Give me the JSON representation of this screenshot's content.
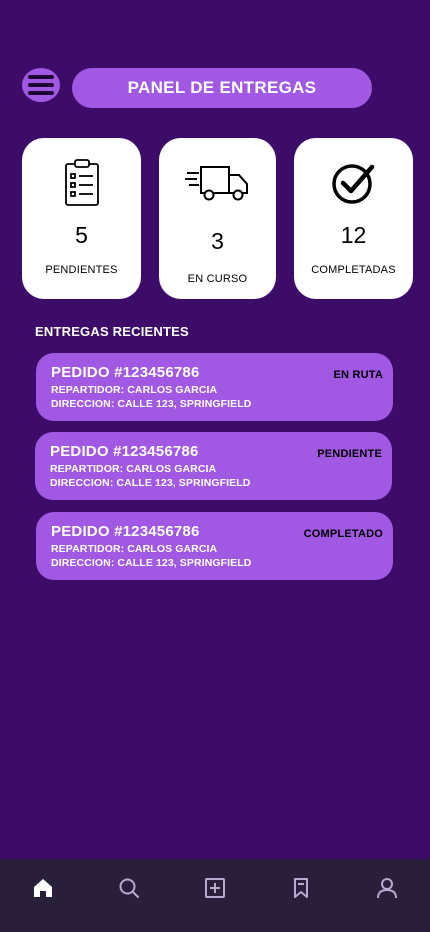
{
  "header": {
    "title": "PANEL DE ENTREGAS",
    "menu_icon": "hamburger-menu-icon"
  },
  "stats": [
    {
      "icon": "clipboard-list-icon",
      "value": "5",
      "label": "PENDIENTES"
    },
    {
      "icon": "delivery-truck-icon",
      "value": "3",
      "label": "EN CURSO"
    },
    {
      "icon": "check-circle-icon",
      "value": "12",
      "label": "COMPLETADAS"
    }
  ],
  "recent": {
    "title": "ENTREGAS RECIENTES",
    "orders": [
      {
        "id": "PEDIDO #123456786",
        "courier": "REPARTIDOR: CARLOS GARCIA",
        "address": "DIRECCION: CALLE 123, SPRINGFIELD",
        "status": "EN RUTA"
      },
      {
        "id": "PEDIDO #123456786",
        "courier": "REPARTIDOR: CARLOS GARCIA",
        "address": "DIRECCION: CALLE 123, SPRINGFIELD",
        "status": "PENDIENTE"
      },
      {
        "id": "PEDIDO #123456786",
        "courier": "REPARTIDOR: CARLOS GARCIA",
        "address": "DIRECCION: CALLE 123, SPRINGFIELD",
        "status": "COMPLETADO"
      }
    ]
  },
  "nav": {
    "items": [
      "home-icon",
      "search-icon",
      "add-square-icon",
      "bookmark-icon",
      "user-icon"
    ],
    "active_color": "#ffffff",
    "inactive_color": "#b9a9cf"
  },
  "colors": {
    "background": "#3d0c69",
    "accent": "#a158e3",
    "nav_background": "#2a1f3a"
  }
}
